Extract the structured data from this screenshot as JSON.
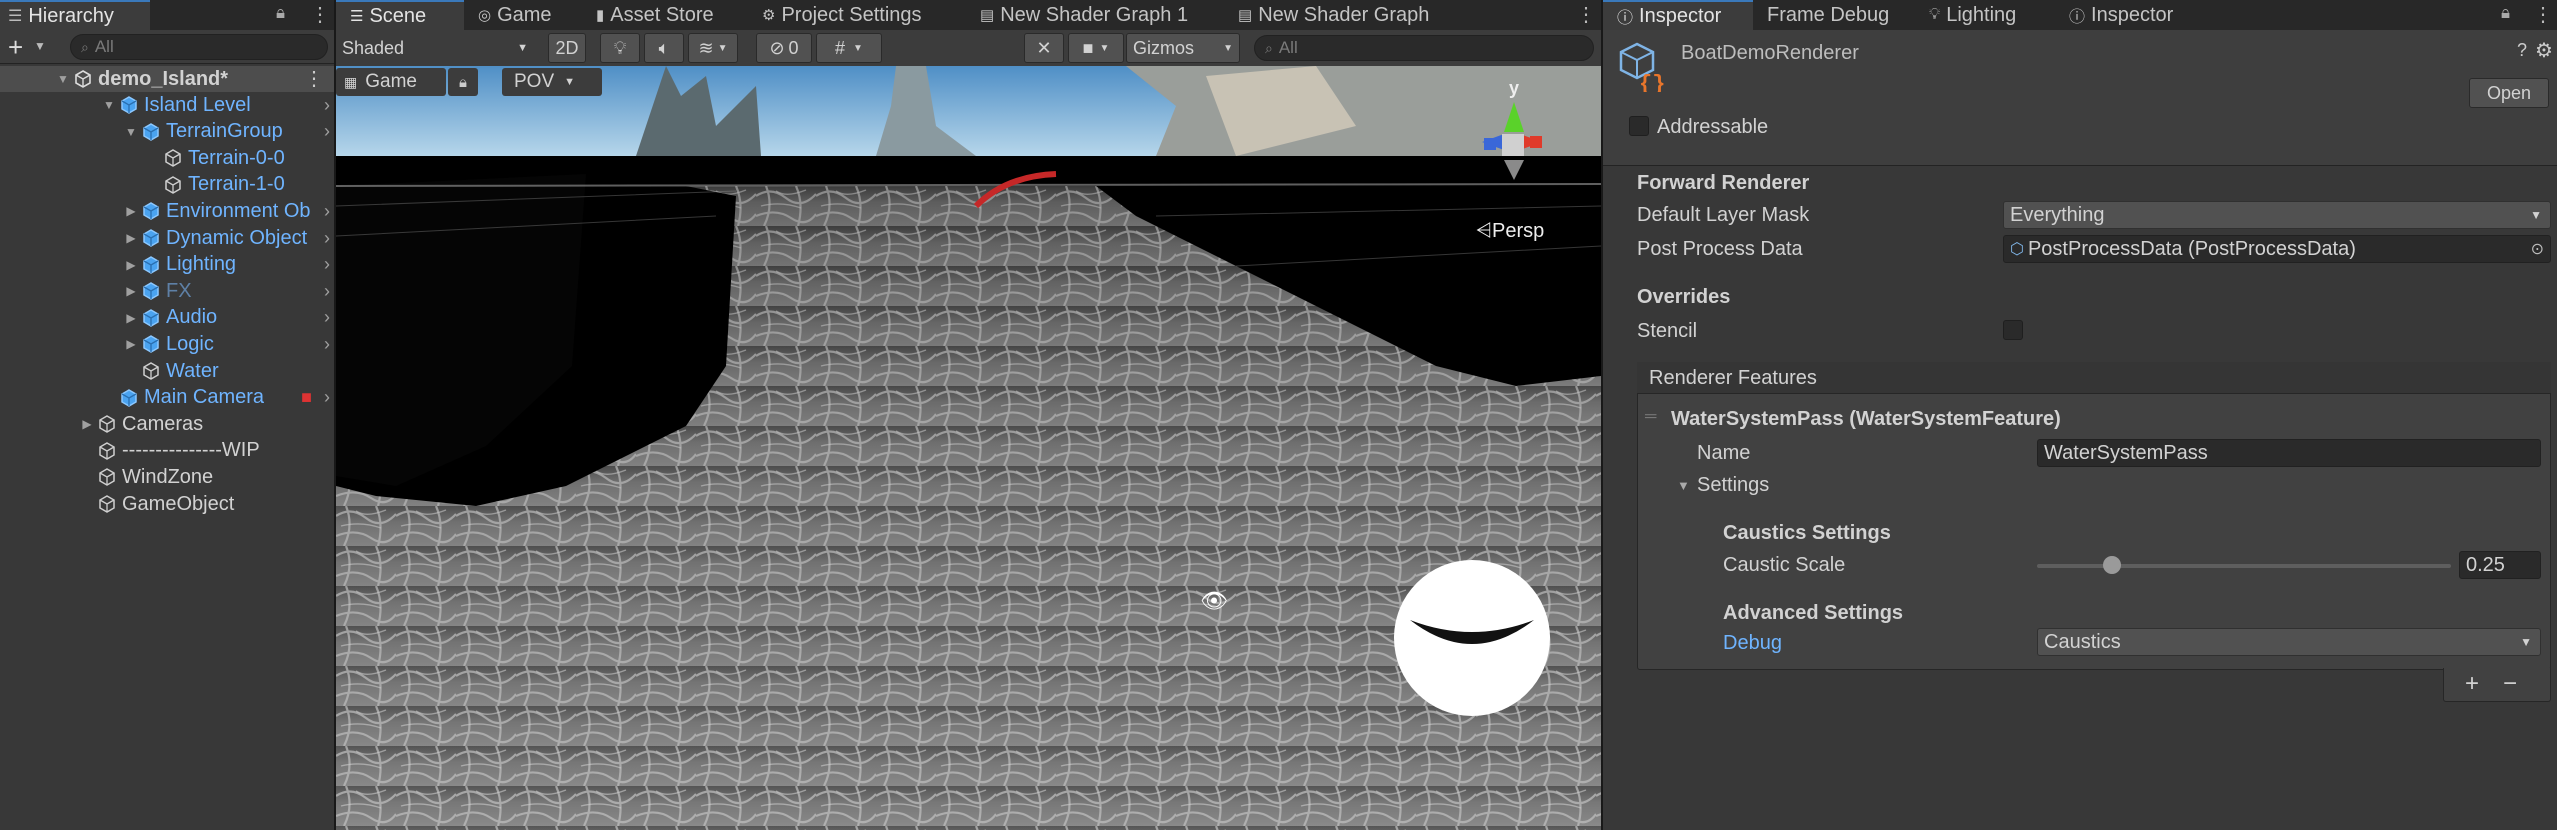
{
  "hierarchy": {
    "tab_label": "Hierarchy",
    "search_placeholder": "All",
    "add_label": "+",
    "scene_name": "demo_Island*",
    "items": [
      {
        "label": "Island Level",
        "style": "blue",
        "indent": 1,
        "arrow": "open",
        "chev": true
      },
      {
        "label": "TerrainGroup",
        "style": "blue",
        "indent": 2,
        "arrow": "open",
        "chev": true
      },
      {
        "label": "Terrain-0-0",
        "style": "blue",
        "indent": 3,
        "arrow": "",
        "chev": false,
        "outline": true
      },
      {
        "label": "Terrain-1-0",
        "style": "blue",
        "indent": 3,
        "arrow": "",
        "chev": false,
        "outline": true
      },
      {
        "label": "Environment Ob",
        "style": "blue",
        "indent": 2,
        "arrow": "closed",
        "chev": true
      },
      {
        "label": "Dynamic Object",
        "style": "blue",
        "indent": 2,
        "arrow": "closed",
        "chev": true
      },
      {
        "label": "Lighting",
        "style": "blue",
        "indent": 2,
        "arrow": "closed",
        "chev": true
      },
      {
        "label": "FX",
        "style": "dim",
        "indent": 2,
        "arrow": "closed",
        "chev": true
      },
      {
        "label": "Audio",
        "style": "blue",
        "indent": 2,
        "arrow": "closed",
        "chev": true
      },
      {
        "label": "Logic",
        "style": "blue",
        "indent": 2,
        "arrow": "closed",
        "chev": true
      },
      {
        "label": "Water",
        "style": "blue",
        "indent": 2,
        "arrow": "",
        "chev": false,
        "outline": true
      },
      {
        "label": "Main Camera",
        "style": "blue",
        "indent": 1,
        "arrow": "",
        "chev": true,
        "camera": true
      },
      {
        "label": "Cameras",
        "style": "lbl",
        "indent": 0,
        "arrow": "closed",
        "chev": false,
        "outline": true
      },
      {
        "label": "---------------WIP",
        "style": "lbl",
        "indent": 0,
        "arrow": "",
        "chev": false,
        "outline": true
      },
      {
        "label": "WindZone",
        "style": "lbl",
        "indent": 0,
        "arrow": "",
        "chev": false,
        "outline": true
      },
      {
        "label": "GameObject",
        "style": "lbl",
        "indent": 0,
        "arrow": "",
        "chev": false,
        "outline": true
      }
    ]
  },
  "center_tabs": [
    {
      "label": "Scene",
      "icon": "scene-icon",
      "active": true
    },
    {
      "label": "Game",
      "icon": "gamepad-icon",
      "active": false
    },
    {
      "label": "Asset Store",
      "icon": "bag-icon",
      "active": false
    },
    {
      "label": "Project Settings",
      "icon": "gear-icon",
      "active": false
    },
    {
      "label": "New Shader Graph 1",
      "icon": "shader-graph-icon",
      "active": false
    },
    {
      "label": "New Shader Graph",
      "icon": "shader-graph-icon",
      "active": false
    }
  ],
  "scene_toolbar": {
    "shading_mode": "Shaded",
    "mode_2d": "2D",
    "hidden_count": "0",
    "gizmos": "Gizmos",
    "search_placeholder": "All",
    "overlay_game": "Game",
    "overlay_pov": "POV",
    "persp_label": "Persp",
    "axis_y": "y"
  },
  "right_tabs": [
    {
      "label": "Inspector",
      "icon": "info-icon",
      "active": true
    },
    {
      "label": "Frame Debug",
      "icon": "",
      "active": false
    },
    {
      "label": "Lighting",
      "icon": "bulb-icon",
      "active": false
    },
    {
      "label": "Inspector",
      "icon": "info-icon",
      "active": false
    }
  ],
  "inspector": {
    "asset_name": "BoatDemoRenderer",
    "open_button": "Open",
    "addressable": "Addressable",
    "forward_renderer": "Forward Renderer",
    "default_layer_mask_label": "Default Layer Mask",
    "default_layer_mask_value": "Everything",
    "post_process_label": "Post Process Data",
    "post_process_value": "PostProcessData (PostProcessData)",
    "overrides": "Overrides",
    "stencil": "Stencil",
    "renderer_features": "Renderer Features",
    "pass_title": "WaterSystemPass (WaterSystemFeature)",
    "name_label": "Name",
    "name_value": "WaterSystemPass",
    "settings_label": "Settings",
    "caustics_settings": "Caustics Settings",
    "caustic_scale_label": "Caustic Scale",
    "caustic_scale_value": "0.25",
    "caustic_scale_fraction": 0.18,
    "advanced_settings": "Advanced Settings",
    "debug_label": "Debug",
    "debug_value": "Caustics",
    "add_label": "+",
    "remove_label": "−"
  },
  "colors": {
    "accent": "#3a79bb",
    "link_blue": "#6fb4ff",
    "panel": "#383838"
  }
}
